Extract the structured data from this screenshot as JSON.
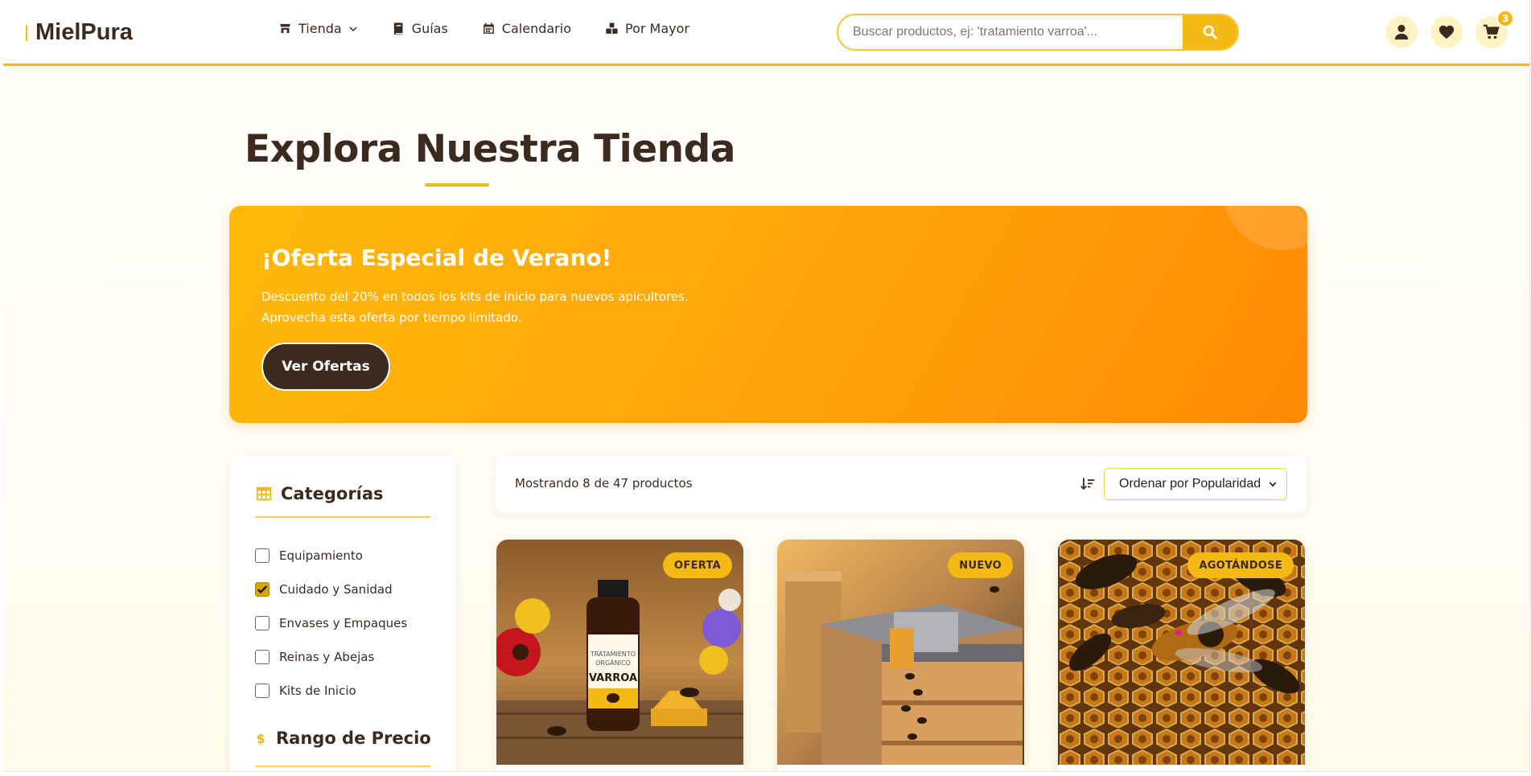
{
  "brand": {
    "name": "MielPura"
  },
  "nav": {
    "items": [
      {
        "label": "Tienda",
        "icon": "store-icon"
      },
      {
        "label": "Guías",
        "icon": "book-icon"
      },
      {
        "label": "Calendario",
        "icon": "calendar-icon"
      },
      {
        "label": "Por Mayor",
        "icon": "boxes-icon"
      }
    ]
  },
  "search": {
    "placeholder": "Buscar productos, ej: 'tratamiento varroa'..."
  },
  "header_actions": {
    "cart_count": "3"
  },
  "page": {
    "title": "Explora Nuestra Tienda"
  },
  "promo": {
    "title": "¡Oferta Especial de Verano!",
    "text": "Descuento del 20% en todos los kits de inicio para nuevos apicultores. Aprovecha esta oferta por tiempo limitado.",
    "button": "Ver Ofertas"
  },
  "sidebar": {
    "categories_title": "Categorías",
    "categories": [
      {
        "label": "Equipamiento",
        "checked": false
      },
      {
        "label": "Cuidado y Sanidad",
        "checked": true
      },
      {
        "label": "Envases y Empaques",
        "checked": false
      },
      {
        "label": "Reinas y Abejas",
        "checked": false
      },
      {
        "label": "Kits de Inicio",
        "checked": false
      }
    ],
    "price_title": "Rango de Precio"
  },
  "toolbar": {
    "results": "Mostrando 8 de 47 productos",
    "sort_selected": "Ordenar por Popularidad"
  },
  "products": [
    {
      "badge": "OFERTA",
      "bottle_line1": "TRATAMIENTO",
      "bottle_line2": "ORGÁNICO",
      "bottle_name": "VARROA"
    },
    {
      "badge": "NUEVO"
    },
    {
      "badge": "AGOTÁNDOSE"
    }
  ],
  "colors": {
    "accent": "#f5b914",
    "dark": "#3d2a1f",
    "promo_start": "#ffb90a",
    "promo_end": "#ff8a05"
  }
}
